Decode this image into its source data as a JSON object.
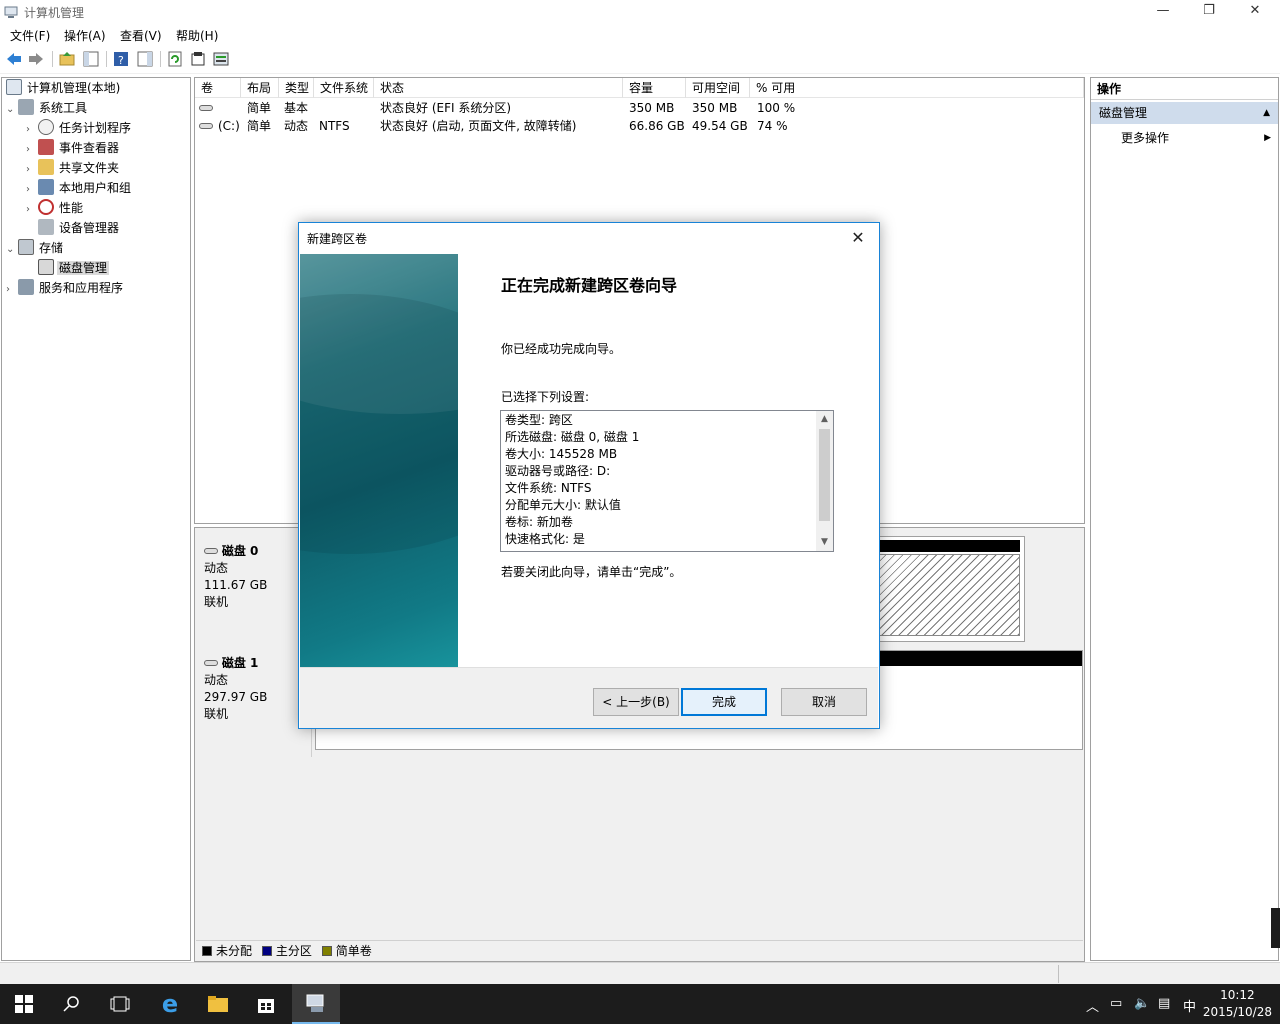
{
  "window": {
    "title": "计算机管理",
    "minimize": "—",
    "maximize": "❐",
    "close": "✕"
  },
  "menu": [
    "文件(F)",
    "操作(A)",
    "查看(V)",
    "帮助(H)"
  ],
  "tree": {
    "root": "计算机管理(本地)",
    "system_tools": "系统工具",
    "task_scheduler": "任务计划程序",
    "event_viewer": "事件查看器",
    "shared_folders": "共享文件夹",
    "local_users": "本地用户和组",
    "performance": "性能",
    "device_manager": "设备管理器",
    "storage": "存储",
    "disk_management": "磁盘管理",
    "services_apps": "服务和应用程序"
  },
  "volume_list": {
    "columns": [
      "卷",
      "布局",
      "类型",
      "文件系统",
      "状态",
      "容量",
      "可用空间",
      "% 可用"
    ],
    "rows": [
      {
        "volume": "",
        "layout": "简单",
        "type": "基本",
        "fs": "",
        "status": "状态良好 (EFI 系统分区)",
        "capacity": "350 MB",
        "free": "350 MB",
        "pct": "100 %"
      },
      {
        "volume": "(C:)",
        "layout": "简单",
        "type": "动态",
        "fs": "NTFS",
        "status": "状态良好 (启动, 页面文件, 故障转储)",
        "capacity": "66.86 GB",
        "free": "49.54 GB",
        "pct": "74 %"
      }
    ]
  },
  "disks": [
    {
      "name": "磁盘 0",
      "type": "动态",
      "size": "111.67 GB",
      "state": "联机"
    },
    {
      "name": "磁盘 1",
      "type": "动态",
      "size": "297.97 GB",
      "state": "联机"
    }
  ],
  "legend": [
    {
      "label": "未分配",
      "color": "#000000"
    },
    {
      "label": "主分区",
      "color": "#000080"
    },
    {
      "label": "简单卷",
      "color": "#808000"
    }
  ],
  "actions": {
    "header": "操作",
    "section": "磁盘管理",
    "more": "更多操作"
  },
  "dialog": {
    "title": "新建跨区卷",
    "heading": "正在完成新建跨区卷向导",
    "success_text": "你已经成功完成向导。",
    "settings_label": "已选择下列设置:",
    "settings": [
      "卷类型: 跨区",
      "所选磁盘: 磁盘 0, 磁盘 1",
      "卷大小: 145528 MB",
      "驱动器号或路径: D:",
      "文件系统: NTFS",
      "分配单元大小: 默认值",
      "卷标: 新加卷",
      "快速格式化: 是"
    ],
    "close_hint": "若要关闭此向导，请单击“完成”。",
    "back_button": "< 上一步(B)",
    "finish_button": "完成",
    "cancel_button": "取消"
  },
  "taskbar": {
    "ime": "中",
    "time": "10:12",
    "date": "2015/10/28"
  },
  "colors": {
    "accent": "#0078d7",
    "taskbar": "#1c1c1c",
    "action_section": "#cfdcec"
  }
}
